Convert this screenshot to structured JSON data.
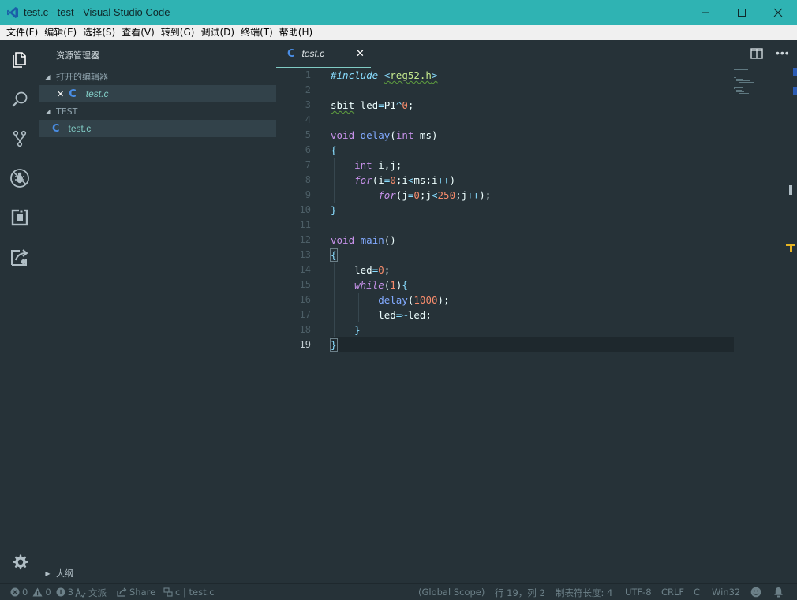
{
  "window": {
    "title": "test.c - test - Visual Studio Code",
    "controls": {
      "minimize": "minimize",
      "maximize": "maximize",
      "close": "close"
    }
  },
  "menu": [
    "文件(F)",
    "编辑(E)",
    "选择(S)",
    "查看(V)",
    "转到(G)",
    "调试(D)",
    "终端(T)",
    "帮助(H)"
  ],
  "activity": [
    "files-icon",
    "search-icon",
    "source-control-icon",
    "debug-icon",
    "extensions-icon",
    "remote-icon",
    "settings-gear-icon"
  ],
  "sidebar": {
    "title": "资源管理器",
    "open_editors": {
      "header": "打开的编辑器",
      "items": [
        {
          "close": "✕",
          "lang": "C",
          "label": "test.c"
        }
      ]
    },
    "folder": {
      "header": "TEST",
      "items": [
        {
          "lang": "C",
          "label": "test.c"
        }
      ]
    },
    "outline": "大纲"
  },
  "tabs": [
    {
      "lang": "C",
      "label": "test.c",
      "close": "✕"
    }
  ],
  "editor": {
    "line_numbers": [
      "1",
      "2",
      "3",
      "4",
      "5",
      "6",
      "7",
      "8",
      "9",
      "10",
      "11",
      "12",
      "13",
      "14",
      "15",
      "16",
      "17",
      "18",
      "19"
    ],
    "current_line": 19,
    "code": [
      "#include <reg52.h>",
      "",
      "sbit led=P1^0;",
      "",
      "void delay(int ms)",
      "{",
      "    int i,j;",
      "    for(i=0;i<ms;i++)",
      "        for(j=0;j<250;j++);",
      "}",
      "",
      "void main()",
      "{",
      "    led=0;",
      "    while(1){",
      "        delay(1000);",
      "        led=~led;",
      "    }",
      "}"
    ]
  },
  "status": {
    "errors": "0",
    "warnings": "0",
    "infos": "3",
    "lint": "文派",
    "share": "Share",
    "context": "c | test.c",
    "scope": "(Global Scope)",
    "position": "行 19，列 2",
    "tab_size": "制表符长度: 4",
    "encoding": "UTF-8",
    "eol": "CRLF",
    "language": "C",
    "platform": "Win32"
  },
  "colors": {
    "titlebar": "#2fb3b3",
    "background": "#263238",
    "accent": "#80cbc4",
    "c_icon": "#4a8ee6"
  }
}
